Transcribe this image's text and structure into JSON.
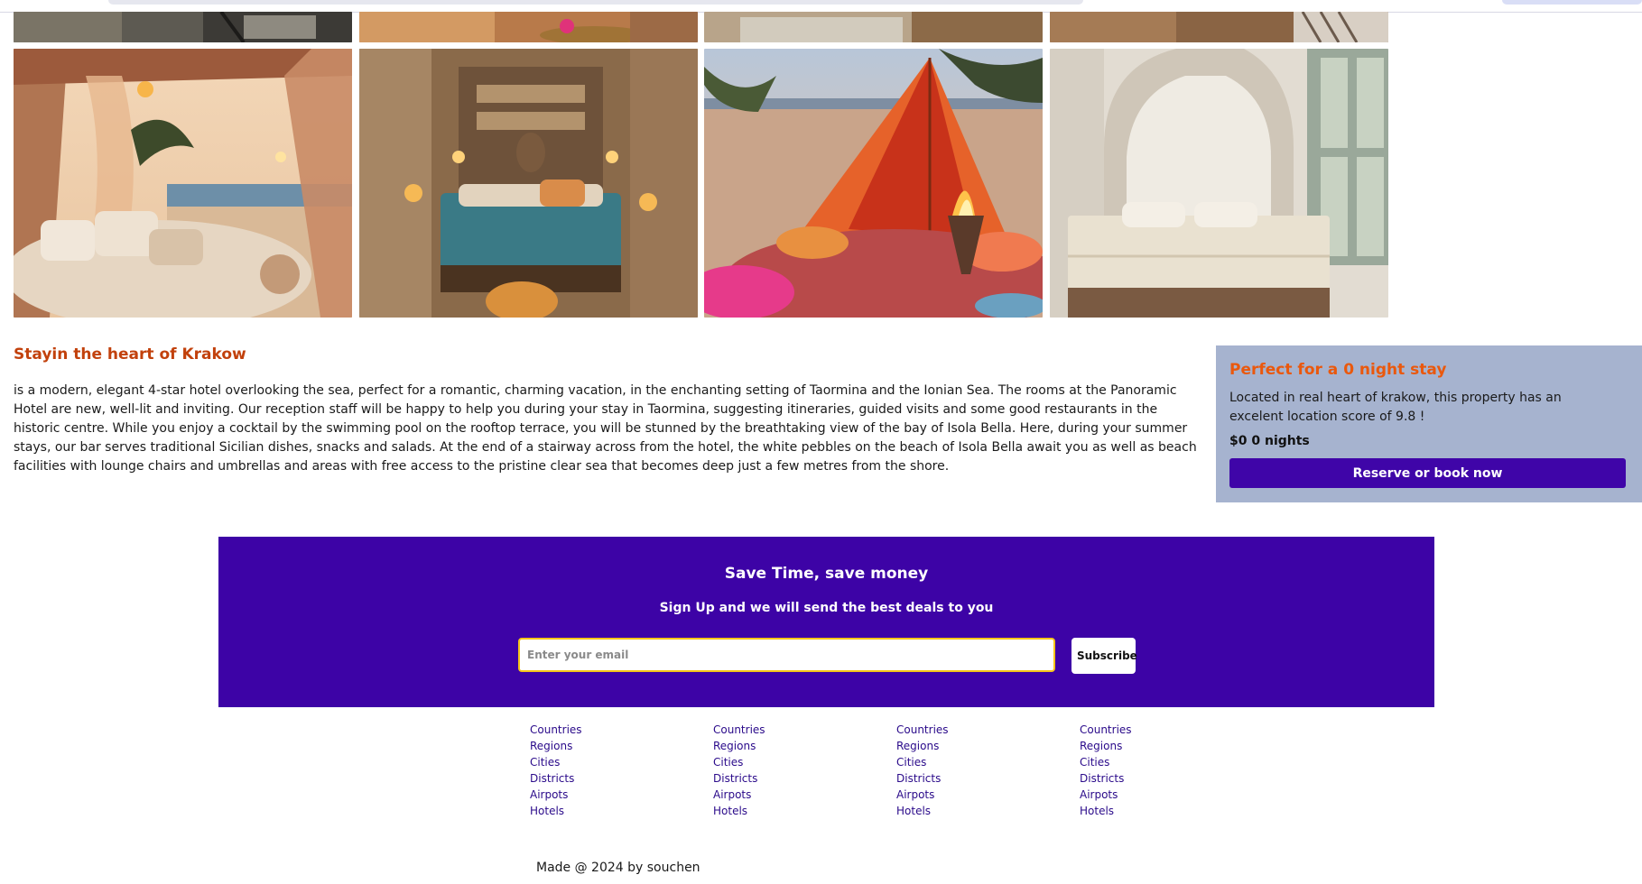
{
  "colors": {
    "accent_purple": "#3d03a6",
    "title_orange": "#c2410c",
    "card_bg": "#a6b3cf",
    "card_title": "#ea580c",
    "input_border": "#f5c518"
  },
  "gallery": {
    "top_row": [
      "lounge-photo",
      "candle-room-photo",
      "bedroom-photo",
      "wood-room-photo"
    ],
    "main_row": [
      "beach-canopy-photo",
      "stone-bedroom-photo",
      "beach-tent-firepit-photo",
      "white-arch-bedroom-photo"
    ]
  },
  "property": {
    "title": "Stayin the heart of Krakow",
    "description": "is a modern, elegant 4-star hotel overlooking the sea, perfect for a romantic, charming vacation, in the enchanting setting of Taormina and the Ionian Sea. The rooms at the Panoramic Hotel are new, well-lit and inviting. Our reception staff will be happy to help you during your stay in Taormina, suggesting itineraries, guided visits and some good restaurants in the historic centre. While you enjoy a cocktail by the swimming pool on the rooftop terrace, you will be stunned by the breathtaking view of the bay of Isola Bella. Here, during your summer stays, our bar serves traditional Sicilian dishes, snacks and salads. At the end of a stairway across from the hotel, the white pebbles on the beach of Isola Bella await you as well as beach facilities with lounge chairs and umbrellas and areas with free access to the pristine clear sea that becomes deep just a few metres from the shore."
  },
  "booking_card": {
    "title": "Perfect for a 0 night stay",
    "text": "Located in real heart of krakow, this property has an excelent location score of 9.8 !",
    "price": "$0 0 nights",
    "button_label": "Reserve or book now"
  },
  "newsletter": {
    "title": "Save Time, save money",
    "subtitle": "Sign Up and we will send the best deals to you",
    "email_placeholder": "Enter your email",
    "email_value": "",
    "subscribe_label": "Subscribe"
  },
  "footer": {
    "columns": [
      {
        "links": [
          "Countries",
          "Regions",
          "Cities",
          "Districts",
          "Airpots",
          "Hotels"
        ]
      },
      {
        "links": [
          "Countries",
          "Regions",
          "Cities",
          "Districts",
          "Airpots",
          "Hotels"
        ]
      },
      {
        "links": [
          "Countries",
          "Regions",
          "Cities",
          "Districts",
          "Airpots",
          "Hotels"
        ]
      },
      {
        "links": [
          "Countries",
          "Regions",
          "Cities",
          "Districts",
          "Airpots",
          "Hotels"
        ]
      }
    ],
    "credit": "Made @ 2024 by souchen"
  }
}
